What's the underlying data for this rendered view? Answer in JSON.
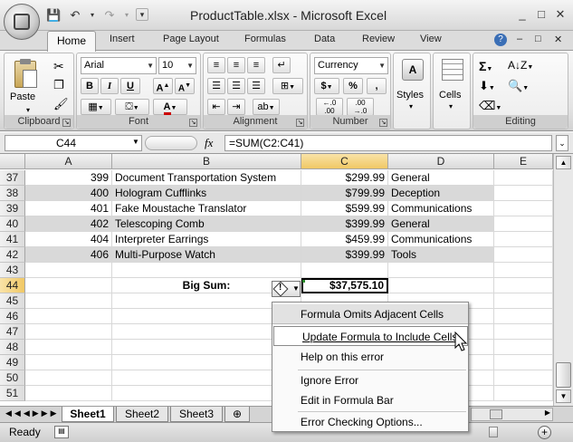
{
  "window": {
    "title": "ProductTable.xlsx - Microsoft Excel",
    "minimize": "_",
    "restore": "□",
    "close": "✕"
  },
  "qat": {
    "save": "💾",
    "undo": "↶",
    "redo": "↷"
  },
  "tabs": [
    "Home",
    "Insert",
    "Page Layout",
    "Formulas",
    "Data",
    "Review",
    "View"
  ],
  "ribbon": {
    "clipboard": {
      "label": "Clipboard",
      "paste": "Paste"
    },
    "font": {
      "label": "Font",
      "name": "Arial",
      "size": "10",
      "bold": "B",
      "italic": "I",
      "underline": "U",
      "grow": "A",
      "shrink": "A",
      "color_letter": "A"
    },
    "alignment": {
      "label": "Alignment"
    },
    "number": {
      "label": "Number",
      "format": "Currency",
      "currency": "$",
      "percent": "%",
      "comma": ",",
      "inc_decimal": "←.0\n.00",
      "dec_decimal": ".00\n→.0"
    },
    "styles": {
      "label": "Styles"
    },
    "cells": {
      "label": "Cells"
    },
    "editing": {
      "label": "Editing",
      "sum": "Σ"
    }
  },
  "formula_bar": {
    "name_box": "C44",
    "fx": "fx",
    "formula": "=SUM(C2:C41)"
  },
  "columns": [
    "A",
    "B",
    "C",
    "D",
    "E"
  ],
  "rows": [
    {
      "num": "37",
      "a": "399",
      "b": "Document Transportation System",
      "c": "$299.99",
      "d": "General"
    },
    {
      "num": "38",
      "a": "400",
      "b": "Hologram Cufflinks",
      "c": "$799.99",
      "d": "Deception"
    },
    {
      "num": "39",
      "a": "401",
      "b": "Fake Moustache Translator",
      "c": "$599.99",
      "d": "Communications"
    },
    {
      "num": "40",
      "a": "402",
      "b": "Telescoping Comb",
      "c": "$399.99",
      "d": "General"
    },
    {
      "num": "41",
      "a": "404",
      "b": "Interpreter Earrings",
      "c": "$459.99",
      "d": "Communications"
    },
    {
      "num": "42",
      "a": "406",
      "b": "Multi-Purpose Watch",
      "c": "$399.99",
      "d": "Tools"
    },
    {
      "num": "43",
      "a": "",
      "b": "",
      "c": "",
      "d": ""
    },
    {
      "num": "44",
      "a": "",
      "b": "Big Sum:",
      "c": "$37,575.10",
      "d": ""
    },
    {
      "num": "45",
      "a": "",
      "b": "",
      "c": "",
      "d": ""
    },
    {
      "num": "46",
      "a": "",
      "b": "",
      "c": "",
      "d": ""
    },
    {
      "num": "47",
      "a": "",
      "b": "",
      "c": "",
      "d": ""
    },
    {
      "num": "48",
      "a": "",
      "b": "",
      "c": "",
      "d": ""
    },
    {
      "num": "49",
      "a": "",
      "b": "",
      "c": "",
      "d": ""
    },
    {
      "num": "50",
      "a": "",
      "b": "",
      "c": "",
      "d": ""
    },
    {
      "num": "51",
      "a": "",
      "b": "",
      "c": "",
      "d": ""
    }
  ],
  "error_menu": {
    "header": "Formula Omits Adjacent Cells",
    "update": "Update Formula to Include Cells",
    "help": "Help on this error",
    "ignore": "Ignore Error",
    "edit": "Edit in Formula Bar",
    "options": "Error Checking Options..."
  },
  "sheets": [
    "Sheet1",
    "Sheet2",
    "Sheet3"
  ],
  "status": {
    "ready": "Ready"
  }
}
